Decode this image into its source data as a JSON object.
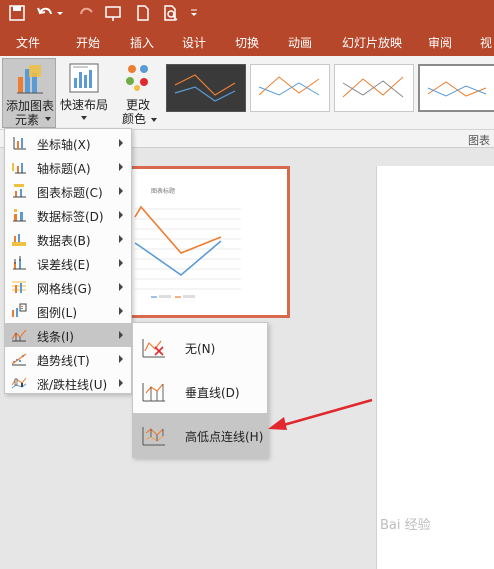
{
  "tabs": [
    "文件",
    "开始",
    "插入",
    "设计",
    "切换",
    "动画",
    "幻灯片放映",
    "审阅",
    "视"
  ],
  "ribbon": {
    "add_element_line1": "添加图表",
    "add_element_line2": "元素",
    "quick_layout": "快速布局",
    "change_colors_line1": "更改",
    "change_colors_line2": "颜色",
    "group_label": "图表"
  },
  "menu_items": [
    {
      "label": "坐标轴(X)"
    },
    {
      "label": "轴标题(A)"
    },
    {
      "label": "图表标题(C)"
    },
    {
      "label": "数据标签(D)"
    },
    {
      "label": "数据表(B)"
    },
    {
      "label": "误差线(E)"
    },
    {
      "label": "网格线(G)"
    },
    {
      "label": "图例(L)"
    },
    {
      "label": "线条(I)"
    },
    {
      "label": "趋势线(T)"
    },
    {
      "label": "涨/跌柱线(U)"
    }
  ],
  "submenu_items": [
    {
      "label": "无(N)"
    },
    {
      "label": "垂直线(D)"
    },
    {
      "label": "高低点连线(H)"
    }
  ],
  "slide_chart": {
    "title": "图表标题"
  },
  "colors": {
    "accent": "#b7472a",
    "slide_border": "#d9694e",
    "orange_line": "#ed7d31",
    "blue_line": "#5b9bd5",
    "arrow": "#e0282e"
  },
  "watermark": "Bai 经验"
}
